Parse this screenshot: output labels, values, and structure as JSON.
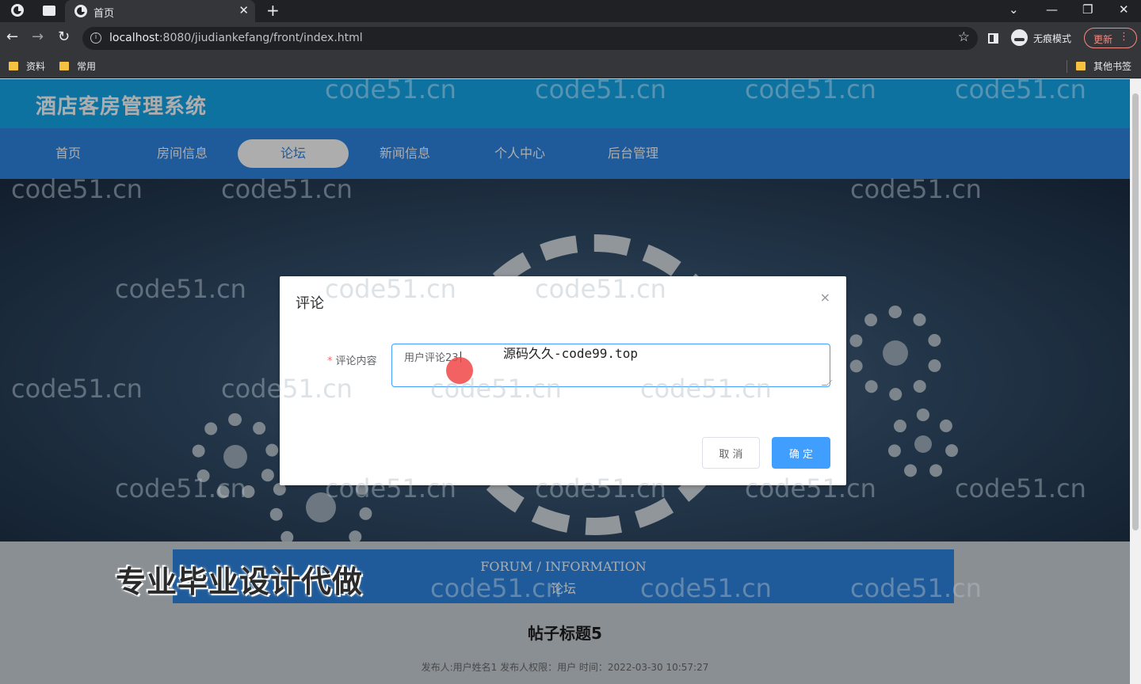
{
  "browser": {
    "tab_title": "首页",
    "tab_close": "✕",
    "new_tab": "+",
    "window_controls": [
      "⌄",
      "—",
      "❐",
      "✕"
    ],
    "nav_back": "←",
    "nav_forward": "→",
    "nav_reload": "↻",
    "info_glyph": "i",
    "url_host": "localhost",
    "url_path": ":8080/jiudiankefang/front/index.html",
    "star": "☆",
    "incognito_label": "无痕模式",
    "update_label": "更新",
    "menu_dots": "⋮",
    "bookmarks": [
      "资料",
      "常用"
    ],
    "other_bookmarks": "其他书签"
  },
  "site": {
    "title": "酒店客房管理系统",
    "nav": [
      "首页",
      "房间信息",
      "论坛",
      "新闻信息",
      "个人中心",
      "后台管理"
    ],
    "active_nav_index": 2,
    "accent": "#2f86e4",
    "header_color": "#15a9ee"
  },
  "forum": {
    "en": "FORUM / INFORMATION",
    "cn": "论坛",
    "post_title": "帖子标题5",
    "post_meta": "发布人:用户姓名1    发布人权限：用户    时间：2022-03-30 10:57:27"
  },
  "promo": "专业毕业设计代做",
  "dialog": {
    "title": "评论",
    "close": "×",
    "required_mark": "*",
    "field_label": "评论内容",
    "field_value": "用户评论23",
    "overlay_text": "源码久久-code99.top",
    "cancel": "取 消",
    "confirm": "确 定"
  },
  "watermark": "code51.cn"
}
